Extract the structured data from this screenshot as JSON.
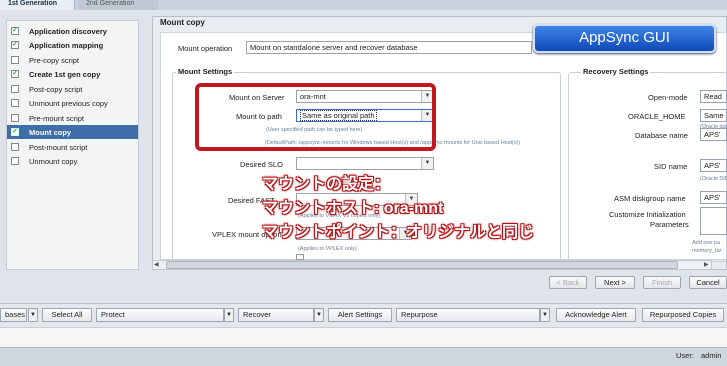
{
  "tabs": {
    "active": "1st Generation",
    "inactive": "2nd Generation"
  },
  "wizard_steps": [
    {
      "label": "Application discovery",
      "checked": true,
      "bold": true
    },
    {
      "label": "Application mapping",
      "checked": true,
      "bold": true
    },
    {
      "label": "Pre-copy script",
      "checked": false,
      "bold": false
    },
    {
      "label": "Create 1st gen copy",
      "checked": true,
      "bold": true
    },
    {
      "label": "Post-copy script",
      "checked": false,
      "bold": false
    },
    {
      "label": "Unmount previous copy",
      "checked": false,
      "bold": false
    },
    {
      "label": "Pre-mount script",
      "checked": false,
      "bold": false
    },
    {
      "label": "Mount copy",
      "checked": true,
      "bold": true,
      "active": true
    },
    {
      "label": "Post-mount script",
      "checked": false,
      "bold": false
    },
    {
      "label": "Unmount copy",
      "checked": false,
      "bold": false
    }
  ],
  "main": {
    "title": "Mount copy",
    "mount_operation_label": "Mount operation",
    "mount_operation_value": "Mount on standalone server and recover database"
  },
  "mount_settings": {
    "title": "Mount Settings",
    "server_label": "Mount on Server",
    "server_value": "ora-mnt",
    "path_label": "Mount to path",
    "path_value": "Same as original path",
    "path_hint1": "(User specified path can be typed here)",
    "path_hint2": "(DefaultPath: /appsync-mounts for Windows based Host(s) and /appsync-mounts for Unix based Host(s))",
    "slo_label": "Desired SLO",
    "slo_value": "",
    "fast_label": "Desired FAST",
    "fast_hint": "(Applies to VMAX V2 copies only)",
    "vplex_label": "VPLEX mount option",
    "vplex_hint": "(Applies to VPLEX only)"
  },
  "recovery_settings": {
    "title": "Recovery Settings",
    "open_mode_label": "Open-mode",
    "open_mode_value": "Read",
    "oracle_home_label": "ORACLE_HOME",
    "oracle_home_value": "Same",
    "oracle_home_hint": "(Oracle database hom",
    "db_name_label": "Database name",
    "db_name_value": "APS'",
    "sid_label": "SID name",
    "sid_value": "APS'",
    "sid_hint": "(Oracle SID will be t",
    "asm_label": "ASM diskgroup name",
    "asm_value": "APS'",
    "init_label_1": "Customize Initialization",
    "init_label_2": "Parameters",
    "init_hint1": "Add one pa",
    "init_hint2": "memory_tar"
  },
  "badge": "AppSync GUI",
  "overlay": {
    "line1": "マウントの設定：",
    "line2": "マウントホスト: ora-mnt",
    "line3": "マウントポイント：オリジナルと同じ"
  },
  "nav": {
    "back": "< Back",
    "next": "Next >",
    "finish": "Finish",
    "cancel": "Cancel"
  },
  "toolbar": {
    "bases": "bases",
    "select_all": "Select All",
    "protect": "Protect",
    "recover": "Recover",
    "alert_settings": "Alert Settings",
    "repurpose": "Repurpose",
    "acknowledge_alert": "Acknowledge Alert",
    "repurposed_copies": "Repurposed Copies"
  },
  "status": {
    "user_label": "User:",
    "user_value": "admin"
  },
  "icons": {
    "dropdown": "chevron-down-icon",
    "check": "checkmark-icon"
  },
  "colors": {
    "active_step": "#3f6ea8",
    "highlight_box": "#c0181c",
    "badge": "#1f5fd0"
  }
}
